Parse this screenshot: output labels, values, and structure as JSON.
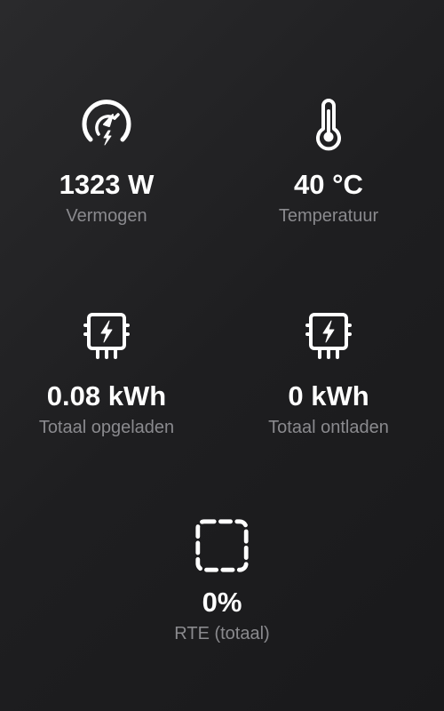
{
  "stats": [
    {
      "icon": "power-gauge-icon",
      "value": "1323 W",
      "label": "Vermogen"
    },
    {
      "icon": "thermometer-icon",
      "value": "40 °C",
      "label": "Temperatuur"
    },
    {
      "icon": "battery-charge-icon",
      "value": "0.08 kWh",
      "label": "Totaal opgeladen"
    },
    {
      "icon": "battery-discharge-icon",
      "value": "0 kWh",
      "label": "Totaal ontladen"
    },
    {
      "icon": "rte-dashed-square-icon",
      "value": "0%",
      "label": "RTE (totaal)"
    }
  ],
  "colors": {
    "background": "#1e1e20",
    "value_text": "#ffffff",
    "label_text": "#8a8a8e",
    "icon": "#ffffff"
  }
}
